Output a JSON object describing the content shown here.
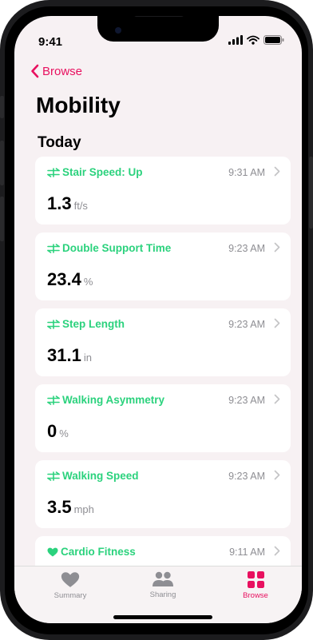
{
  "status_bar": {
    "time": "9:41"
  },
  "nav": {
    "back_label": "Browse"
  },
  "page": {
    "title": "Mobility",
    "section": "Today"
  },
  "colors": {
    "accent": "#e8105f",
    "metric_green": "#2bd27d",
    "secondary_text": "#8e8e93"
  },
  "cards": [
    {
      "title": "Stair Speed: Up",
      "time": "9:31 AM",
      "value": "1.3",
      "unit": "ft/s",
      "icon": "walking-arrows-icon"
    },
    {
      "title": "Double Support Time",
      "time": "9:23 AM",
      "value": "23.4",
      "unit": "%",
      "icon": "walking-arrows-icon"
    },
    {
      "title": "Step Length",
      "time": "9:23 AM",
      "value": "31.1",
      "unit": "in",
      "icon": "walking-arrows-icon"
    },
    {
      "title": "Walking Asymmetry",
      "time": "9:23 AM",
      "value": "0",
      "unit": "%",
      "icon": "walking-arrows-icon"
    },
    {
      "title": "Walking Speed",
      "time": "9:23 AM",
      "value": "3.5",
      "unit": "mph",
      "icon": "walking-arrows-icon"
    },
    {
      "title": "Cardio Fitness",
      "time": "9:11 AM",
      "icon": "heart-icon"
    }
  ],
  "tabs": [
    {
      "label": "Summary",
      "icon": "heart-icon"
    },
    {
      "label": "Sharing",
      "icon": "people-icon"
    },
    {
      "label": "Browse",
      "icon": "grid-icon",
      "selected": true
    }
  ]
}
